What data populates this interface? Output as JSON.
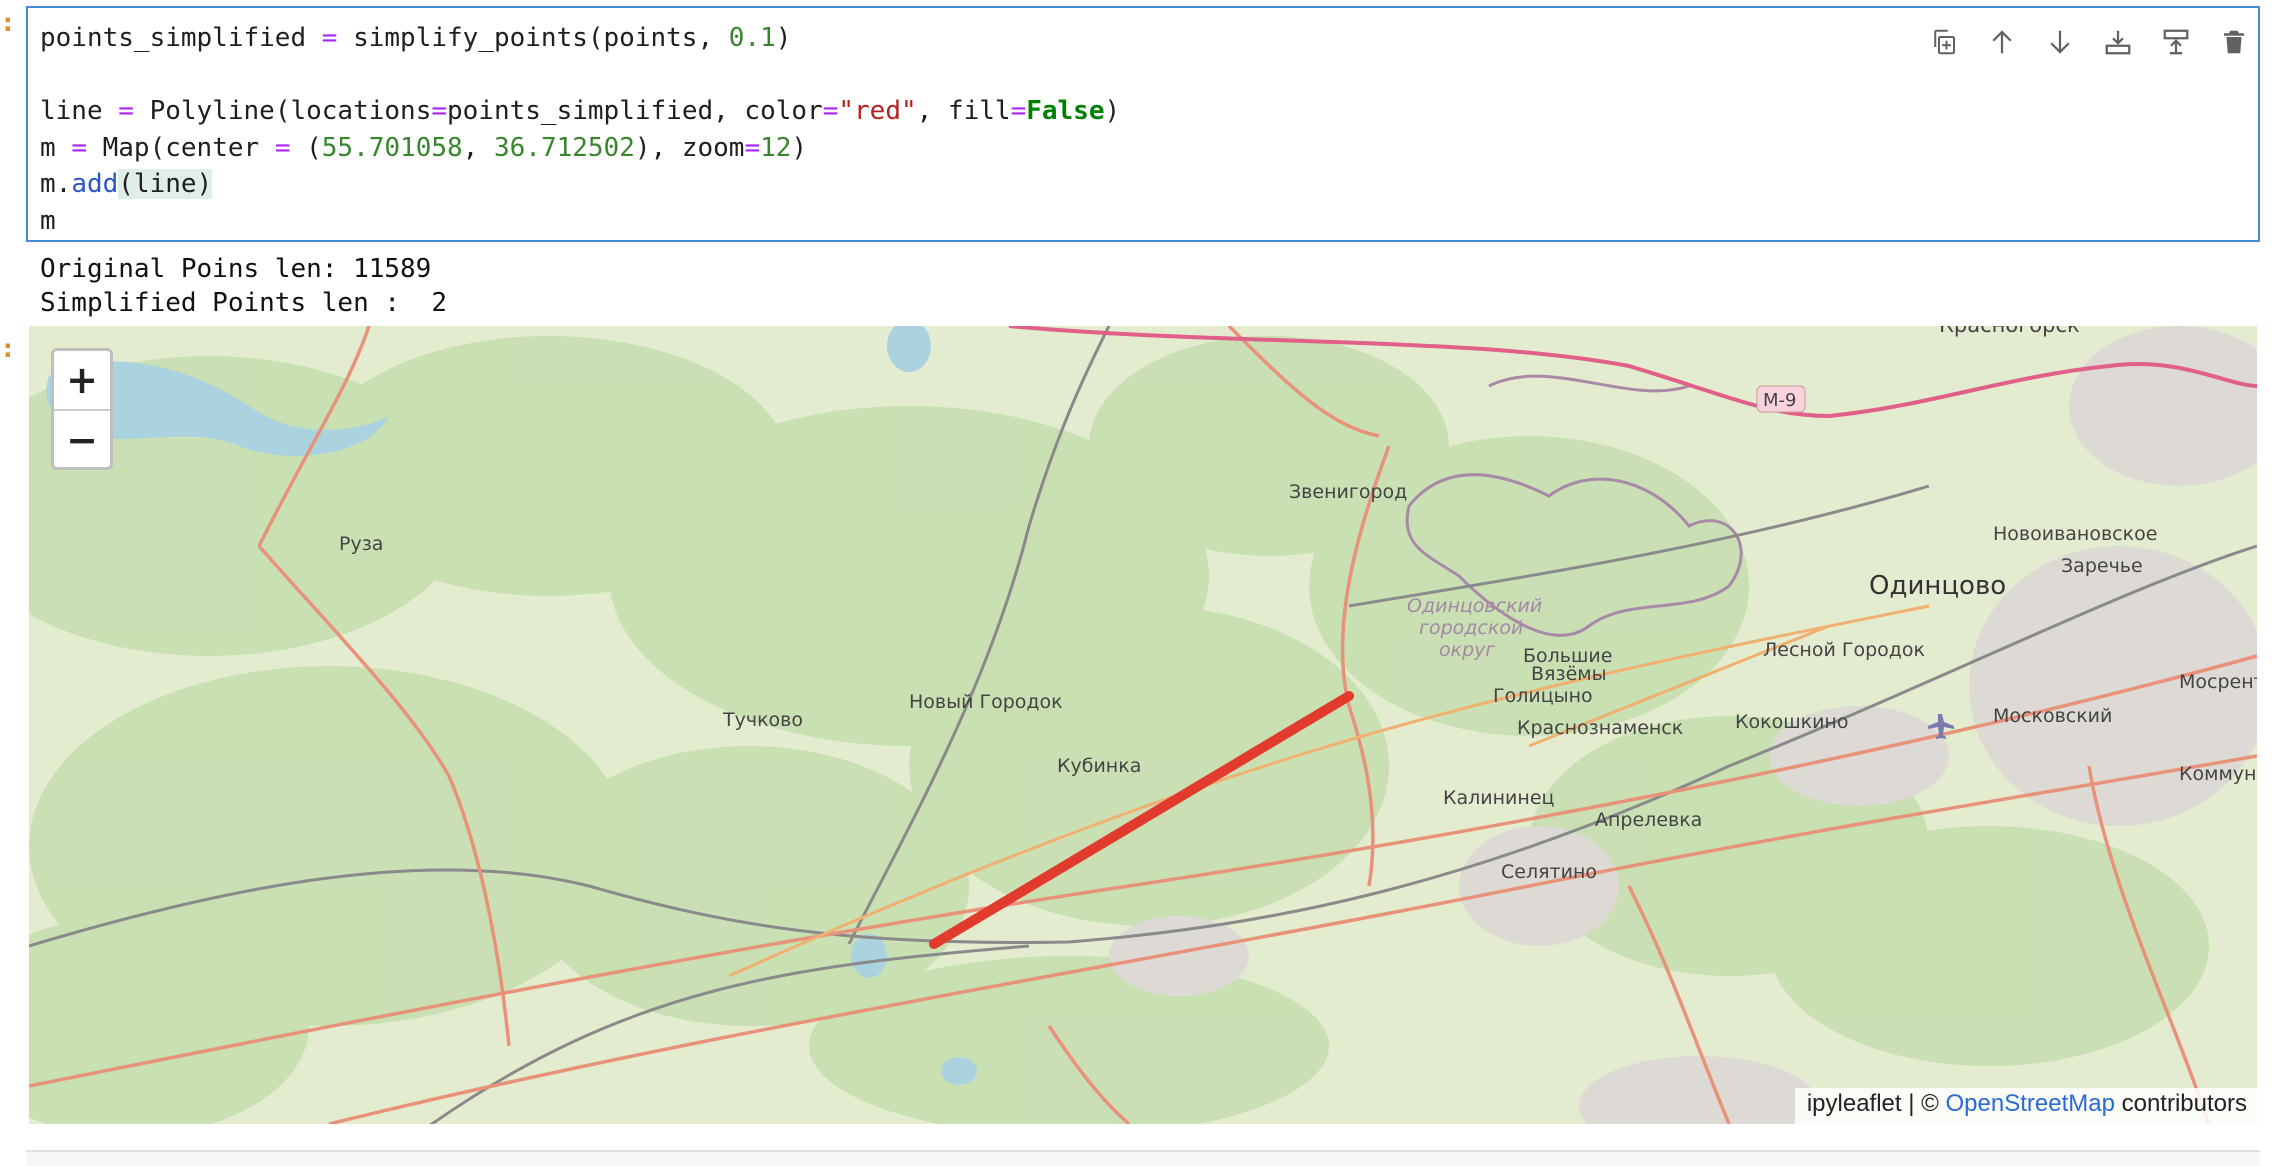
{
  "cell": {
    "prompt_marker": ":",
    "code": {
      "l1_var": "points_simplified",
      "l1_eq": "=",
      "l1_call": "simplify_points(points, ",
      "l1_num": "0.1",
      "l1_end": ")",
      "l3_var": "line",
      "l3_eq": "=",
      "l3_a": "Polyline(locations",
      "l3_eq2": "=",
      "l3_b": "points_simplified, color",
      "l3_eq3": "=",
      "l3_str": "\"red\"",
      "l3_c": ", fill",
      "l3_eq4": "=",
      "l3_kw": "False",
      "l3_end": ")",
      "l4_var": "m",
      "l4_eq": "=",
      "l4_a": "Map(center ",
      "l4_eq2": "=",
      "l4_b": " (",
      "l4_n1": "55.701058",
      "l4_c": ", ",
      "l4_n2": "36.712502",
      "l4_d": "), zoom",
      "l4_eq3": "=",
      "l4_n3": "12",
      "l4_end": ")",
      "l5_a": "m.",
      "l5_call": "add",
      "l5_b": "(line)",
      "l6": "m"
    },
    "toolbar": {
      "duplicate": "duplicate-icon",
      "move_up": "arrow-up-icon",
      "move_down": "arrow-down-icon",
      "insert_above": "insert-above-icon",
      "insert_below": "insert-below-icon",
      "delete": "trash-icon"
    }
  },
  "output": {
    "line1": "Original Poins len: 11589",
    "line2": "Simplified Points len :  2",
    "prompt_marker": ":"
  },
  "map": {
    "zoom_in": "+",
    "zoom_out": "−",
    "polyline_color": "red",
    "polyline_locations_shown": 2,
    "labels": {
      "krasnogorsk": "Красногорск",
      "m9": "М-9",
      "zvenigorod": "Звенигород",
      "ruza": "Руза",
      "novoivanovskoe": "Новоивановское",
      "zarechye": "Заречье",
      "odintsovo": "Одинцово",
      "odintsovo_district_1": "Одинцовский",
      "odintsovo_district_2": "городской",
      "odintsovo_district_3": "округ",
      "bolshie": "Большие",
      "vyazemy": "Вязёмы",
      "lesnoy_gorodok": "Лесной Городок",
      "mosrent": "Мосрент",
      "novy_gorodok": "Новый Городок",
      "golitsyno": "Голицыно",
      "tuchkovo": "Тучково",
      "krasnoznamensk": "Краснознаменск",
      "kokoshkino": "Кокошкино",
      "moskovsky": "Московский",
      "kubinka": "Кубинка",
      "kommuna": "Коммуна",
      "kalininets": "Калининец",
      "aprelevka": "Апрелевка",
      "selyatino": "Селятино"
    },
    "attribution": {
      "prefix": "ipyleaflet | © ",
      "link": "OpenStreetMap",
      "suffix": " contributors"
    }
  }
}
